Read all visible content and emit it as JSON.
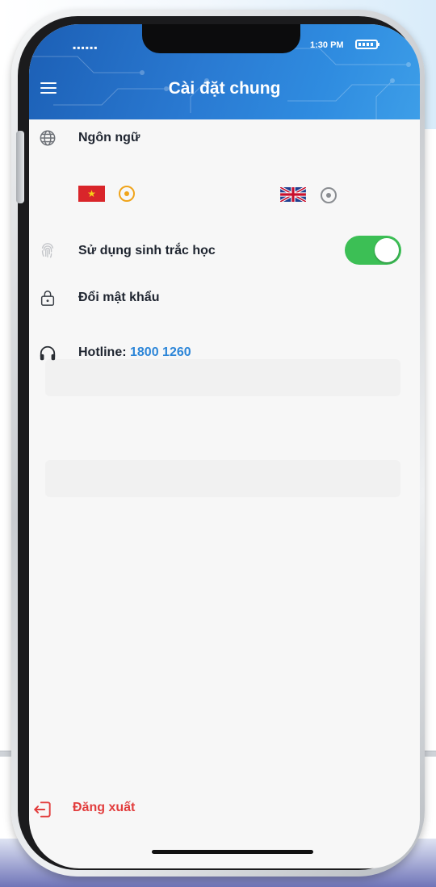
{
  "status_bar": {
    "signal": "▪▪▪▪▪▪",
    "time": "1:30 PM"
  },
  "header": {
    "title": "Cài đặt chung",
    "menu_icon": "hamburger-icon"
  },
  "settings": {
    "language": {
      "label": "Ngôn ngữ",
      "icon": "globe-icon",
      "options": [
        {
          "flag": "vietnam-flag",
          "selected": true
        },
        {
          "flag": "uk-flag",
          "selected": false
        }
      ]
    },
    "biometric": {
      "label": "Sử dụng sinh trắc học",
      "icon": "fingerprint-icon",
      "enabled": true
    },
    "change_password": {
      "label": "Đổi mật khẩu",
      "icon": "lock-icon"
    },
    "hotline": {
      "label": "Hotline:",
      "number": "1800 1260",
      "icon": "headphones-icon"
    }
  },
  "logout": {
    "label": "Đăng xuất",
    "icon": "logout-icon"
  },
  "colors": {
    "header": "#2a7ad2",
    "toggle_on": "#3cbf55",
    "radio_selected": "#f0a41b",
    "hotline_number": "#2d86d8",
    "logout": "#e23d3d"
  }
}
